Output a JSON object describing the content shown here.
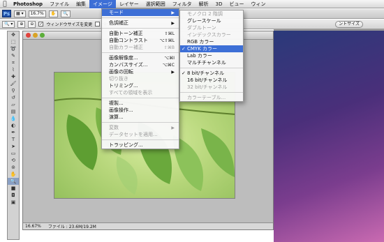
{
  "menubar": {
    "items": [
      "Photoshop",
      "ファイル",
      "編集",
      "イメージ",
      "レイヤー",
      "選択範囲",
      "フィルタ",
      "解析",
      "3D",
      "ビュー",
      "ウィン"
    ]
  },
  "options": {
    "zoom": "16.7%",
    "resize_window": "ウィンドウサイズを変更",
    "all_windows": "全ウ",
    "print_size": "ントサイズ"
  },
  "document": {
    "zoom": "16.67%",
    "file_info": "ファイル : 23.6M/19.2M"
  },
  "image_menu": {
    "mode": "モード",
    "adjustments": "色調補正",
    "auto_tone": "自動トーン補正",
    "auto_tone_sc": "⇧⌘L",
    "auto_contrast": "自動コントラスト",
    "auto_contrast_sc": "⌥⇧⌘L",
    "auto_color": "自動カラー補正",
    "auto_color_sc": "⇧⌘B",
    "image_size": "画像解像度...",
    "image_size_sc": "⌥⌘I",
    "canvas_size": "カンバスサイズ...",
    "canvas_size_sc": "⌥⌘C",
    "rotation": "画像の回転",
    "crop": "切り抜き",
    "trim": "トリミング...",
    "reveal_all": "すべての領域を表示",
    "duplicate": "複製...",
    "apply_image": "画像操作...",
    "calculations": "演算...",
    "variables": "変数",
    "apply_dataset": "データセットを適用...",
    "trap": "トラッピング..."
  },
  "mode_menu": {
    "bitmap": "モノクロ 2 階調",
    "grayscale": "グレースケール",
    "duotone": "ダブルトーン",
    "indexed": "インデックスカラー",
    "rgb": "RGB カラー",
    "cmyk": "CMYK カラー",
    "lab": "Lab カラー",
    "multichannel": "マルチチャンネル",
    "bit8": "8 bit/チャンネル",
    "bit16": "16 bit/チャンネル",
    "bit32": "32 bit/チャンネル",
    "color_table": "カラーテーブル..."
  }
}
